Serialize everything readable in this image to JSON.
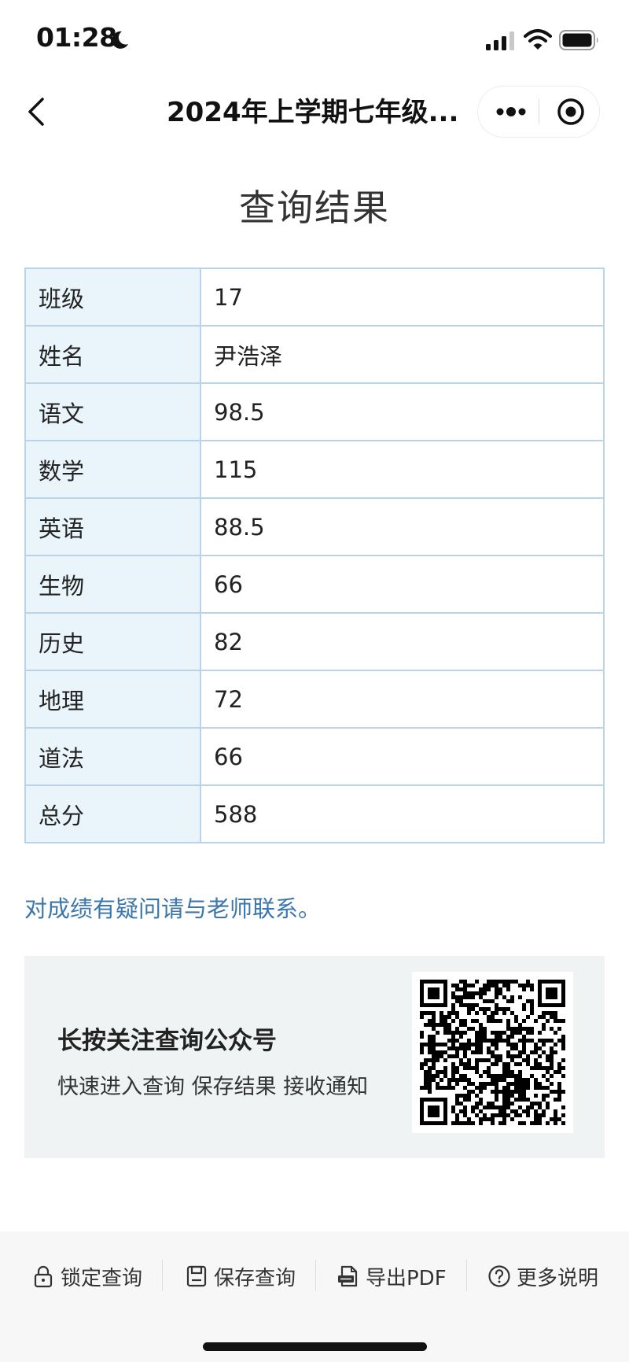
{
  "status_bar": {
    "time": "01:28"
  },
  "nav": {
    "title": "2024年上学期七年级..."
  },
  "page": {
    "title": "查询结果"
  },
  "results": {
    "rows": [
      {
        "label": "班级",
        "value": "17"
      },
      {
        "label": "姓名",
        "value": "尹浩泽"
      },
      {
        "label": "语文",
        "value": "98.5"
      },
      {
        "label": "数学",
        "value": "115"
      },
      {
        "label": "英语",
        "value": "88.5"
      },
      {
        "label": "生物",
        "value": "66"
      },
      {
        "label": "历史",
        "value": "82"
      },
      {
        "label": "地理",
        "value": "72"
      },
      {
        "label": "道法",
        "value": "66"
      },
      {
        "label": "总分",
        "value": "588"
      }
    ]
  },
  "contact_note": "对成绩有疑问请与老师联系。",
  "follow_card": {
    "title": "长按关注查询公众号",
    "description": "快速进入查询 保存结果 接收通知"
  },
  "toolbar": {
    "lock_label": "锁定查询",
    "save_label": "保存查询",
    "export_label": "导出PDF",
    "help_label": "更多说明"
  },
  "colors": {
    "link": "#3b77ad",
    "table_border": "#b9d3e8",
    "label_cell_bg": "#eaf4fb",
    "card_bg": "#eff3f4"
  },
  "icons": [
    "moon-icon",
    "signal-icon",
    "wifi-icon",
    "battery-icon",
    "back-icon",
    "more-icon",
    "close-mini-icon",
    "qr-code",
    "lock-icon",
    "save-icon",
    "pdf-icon",
    "help-icon"
  ]
}
